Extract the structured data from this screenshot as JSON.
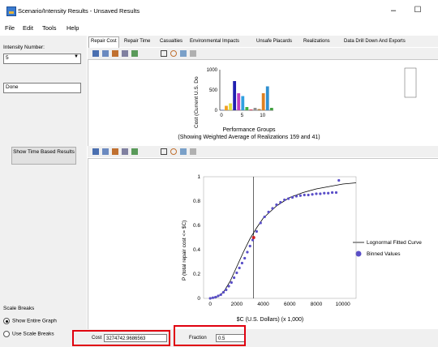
{
  "window": {
    "title": "Scenario/Intensity Results - Unsaved Results",
    "minimize": "–",
    "maximize": "☐"
  },
  "menu": [
    "File",
    "Edit",
    "Tools",
    "Help"
  ],
  "left_panel": {
    "intensity_label": "Intensity Number:",
    "intensity_value": "5",
    "status_value": "Done",
    "show_time_button": "Show Time Based Results",
    "scale_breaks_label": "Scale Breaks",
    "show_entire_graph": "Show Entire Graph",
    "use_scale_breaks": "Use Scale Breaks"
  },
  "tabs": [
    "Repair Cost",
    "Repair Time",
    "Casualties",
    "Environmental Impacts",
    "Unsafe Placards",
    "Realizations",
    "Data Drill Down And Exports"
  ],
  "active_tab": "Repair Cost",
  "status": {
    "cost_label": "Cost",
    "cost_value": "3274742.9686563",
    "fraction_label": "Fraction",
    "fraction_value": "0.5"
  },
  "chart_data": [
    {
      "type": "bar",
      "title": "",
      "xlabel": "Performance Groups",
      "ylabel": "Cost (Current U.S. Do",
      "subtitle": "(Showing Weighted Average of Realizations 159 and 41)",
      "xticks": [
        "0",
        "5",
        "10"
      ],
      "yticks": [
        "0",
        "500",
        "1000"
      ],
      "ylim": [
        0,
        1000
      ],
      "categories": [
        1,
        2,
        3,
        4,
        5,
        6,
        7,
        8,
        9,
        10,
        11,
        12,
        13
      ],
      "values": [
        10,
        110,
        170,
        720,
        420,
        350,
        80,
        20,
        60,
        30,
        420,
        590,
        60
      ],
      "colors": [
        "#3050c8",
        "#f0a020",
        "#e0e040",
        "#2020b0",
        "#c040c0",
        "#30a0e0",
        "#40b040",
        "#e04060",
        "#909090",
        "#b08040",
        "#e08020",
        "#3090d0",
        "#40a040"
      ]
    },
    {
      "type": "scatter",
      "xlabel": "$C (U.S. Dollars) (x 1,000)",
      "ylabel": "P (total repair cost <= $C)",
      "xticks": [
        "0",
        "2000",
        "4000",
        "6000",
        "8000",
        "10000"
      ],
      "yticks": [
        "0",
        "0.2",
        "0.4",
        "0.6",
        "0.8",
        "1"
      ],
      "xlim": [
        -500,
        11000
      ],
      "ylim": [
        0,
        1.0
      ],
      "series": [
        {
          "name": "Lognormal Fitted Curve",
          "kind": "line",
          "color": "#000000",
          "x": [
            0,
            500,
            1000,
            1500,
            2000,
            2500,
            3000,
            3500,
            4000,
            5000,
            6000,
            7000,
            8000,
            9000,
            10000,
            11000
          ],
          "y": [
            0,
            0.01,
            0.05,
            0.14,
            0.26,
            0.38,
            0.49,
            0.58,
            0.66,
            0.76,
            0.83,
            0.87,
            0.9,
            0.92,
            0.94,
            0.95
          ]
        },
        {
          "name": "Binned Values",
          "kind": "points",
          "color": "#5a4fc8",
          "x": [
            0,
            200,
            400,
            600,
            800,
            1000,
            1200,
            1400,
            1600,
            1800,
            2000,
            2200,
            2400,
            2600,
            2800,
            3000,
            3200,
            3500,
            3800,
            4100,
            4400,
            4700,
            5000,
            5300,
            5600,
            5900,
            6200,
            6500,
            6800,
            7100,
            7400,
            7700,
            8000,
            8300,
            8600,
            8900,
            9200,
            9500,
            9700
          ],
          "y": [
            0,
            0.005,
            0.01,
            0.02,
            0.03,
            0.05,
            0.07,
            0.1,
            0.13,
            0.17,
            0.21,
            0.25,
            0.29,
            0.33,
            0.38,
            0.43,
            0.48,
            0.55,
            0.62,
            0.67,
            0.71,
            0.74,
            0.77,
            0.79,
            0.81,
            0.82,
            0.83,
            0.84,
            0.845,
            0.85,
            0.85,
            0.855,
            0.86,
            0.86,
            0.865,
            0.865,
            0.87,
            0.87,
            0.97
          ]
        }
      ],
      "marker": {
        "x": 3274.7,
        "y": 0.5
      },
      "vline_x": 3274.7
    }
  ]
}
